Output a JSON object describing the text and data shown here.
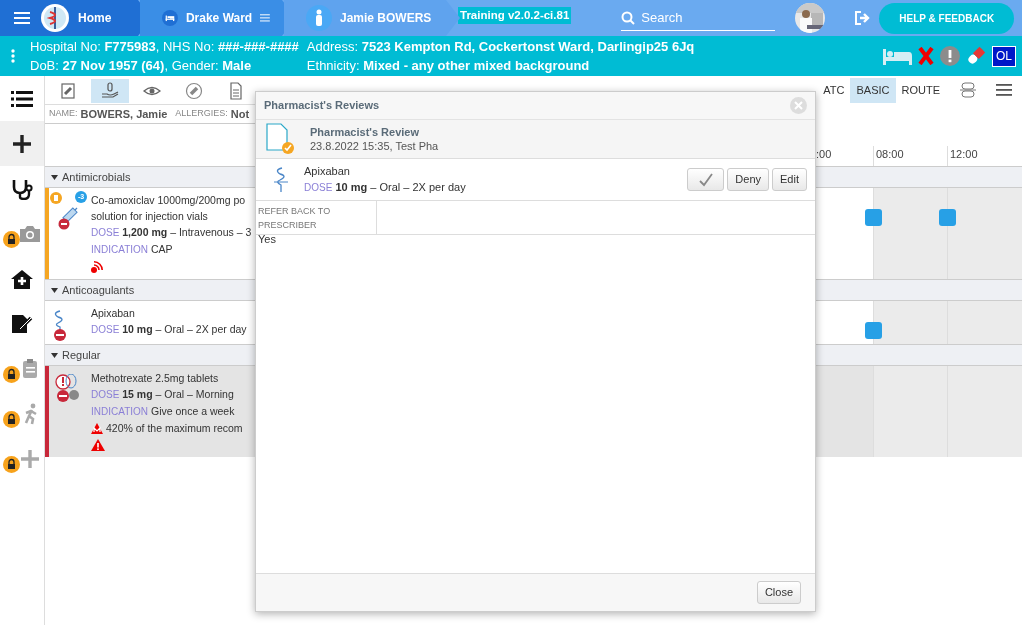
{
  "topbar": {
    "crumbs": [
      {
        "kind": "home",
        "label": "Home"
      },
      {
        "kind": "ward",
        "label": "Drake Ward"
      },
      {
        "kind": "patient",
        "label": "Jamie BOWERS"
      }
    ],
    "environment": "Training v2.0.2-ci.81",
    "search": {
      "placeholder": "Search"
    },
    "help_button": "HELP & FEEDBACK"
  },
  "banner": {
    "left_lines": [
      "Hospital No: **F775983**, NHS No: **###-###-####**",
      "DoB: **27 Nov 1957 (64)**, Gender: **Male**"
    ],
    "right_lines": [
      "Address: **7523 Kempton Rd, Cockertonst Ward, Darlingip25 6Jq**",
      "Ethnicity: **Mixed - any other mixed background**"
    ],
    "alerts": [
      {
        "kind": "bed"
      },
      {
        "kind": "cross"
      },
      {
        "kind": "warning"
      },
      {
        "kind": "pill"
      },
      {
        "kind": "badge",
        "label": "OL"
      }
    ]
  },
  "sidebar": [
    {
      "kind": "list",
      "selected": false,
      "locked": false
    },
    {
      "kind": "plus",
      "selected": true,
      "locked": false
    },
    {
      "kind": "stethoscope",
      "selected": false,
      "locked": false
    },
    {
      "kind": "camera",
      "selected": false,
      "locked": true
    },
    {
      "kind": "house",
      "selected": false,
      "locked": false
    },
    {
      "kind": "edit",
      "selected": false,
      "locked": false
    },
    {
      "kind": "clipboard",
      "selected": false,
      "locked": true
    },
    {
      "kind": "walker",
      "selected": false,
      "locked": true
    },
    {
      "kind": "plus",
      "selected": false,
      "locked": true
    }
  ],
  "toolbar": {
    "tools": [
      {
        "kind": "notebook",
        "selected": false
      },
      {
        "kind": "hand",
        "selected": true
      },
      {
        "kind": "eye",
        "selected": false
      },
      {
        "kind": "pill",
        "selected": false
      },
      {
        "kind": "document",
        "selected": false
      }
    ],
    "views": [
      {
        "label": "ATC",
        "selected": false
      },
      {
        "label": "BASIC",
        "selected": true
      },
      {
        "label": "ROUTE",
        "selected": false
      }
    ]
  },
  "patient_strip": {
    "name_label": "NAME:",
    "name": "BOWERS, Jamie",
    "allergies_label": "ALLERGIES:",
    "allergies": "Not"
  },
  "timeline": {
    "times": [
      ":00",
      "08:00",
      "12:00"
    ]
  },
  "groups": [
    {
      "title": "Antimicrobials",
      "meds": [
        {
          "kind": "syringe",
          "count_badge": "-3",
          "color": "#f5a623",
          "highlighted": false,
          "name_lines": [
            "Co-amoxiclav 1000mg/200mg po",
            "solution for injection vials"
          ],
          "dose_label": "DOSE",
          "dose": "**1,200 mg** – Intravenous – 3",
          "indication_label": "INDICATION",
          "indication": "CAP",
          "footer": {
            "kind": "signal"
          },
          "slots": [
            true,
            true
          ]
        }
      ]
    },
    {
      "title": "Anticoagulants",
      "meds": [
        {
          "kind": "snake",
          "color": "#ffffff",
          "highlighted": false,
          "name_lines": [
            "Apixaban"
          ],
          "dose_label": "DOSE",
          "dose": "**10 mg** – Oral – 2X per day",
          "slots": [
            true,
            false
          ]
        }
      ]
    },
    {
      "title": "Regular",
      "meds": [
        {
          "kind": "pills",
          "color": "#c8283a",
          "highlighted": true,
          "name_lines": [
            "Methotrexate 2.5mg tablets"
          ],
          "dose_label": "DOSE",
          "dose": "**15 mg** – Oral – Morning",
          "indication_label": "INDICATION",
          "indication": "Give once a week",
          "warnings": [
            {
              "kind": "max-dose",
              "text": "420% of the maximum recom"
            }
          ],
          "footer": {
            "kind": "alert"
          },
          "slots": [
            false,
            false
          ]
        }
      ]
    }
  ],
  "modal": {
    "title": "Pharmacist's Reviews",
    "review": {
      "title": "Pharmacist's Review",
      "meta": "23.8.2022 15:35, Test Pha"
    },
    "item": {
      "name": "Apixaban",
      "dose_label": "DOSE",
      "dose": "**10 mg** – Oral – 2X per day",
      "buttons": [
        {
          "kind": "approve"
        },
        {
          "kind": "text",
          "label": "Deny"
        },
        {
          "kind": "text",
          "label": "Edit"
        }
      ]
    },
    "fields": [
      {
        "label": "REFER BACK TO PRESCRIBER",
        "value": "Yes"
      }
    ],
    "close_button": "Close"
  }
}
